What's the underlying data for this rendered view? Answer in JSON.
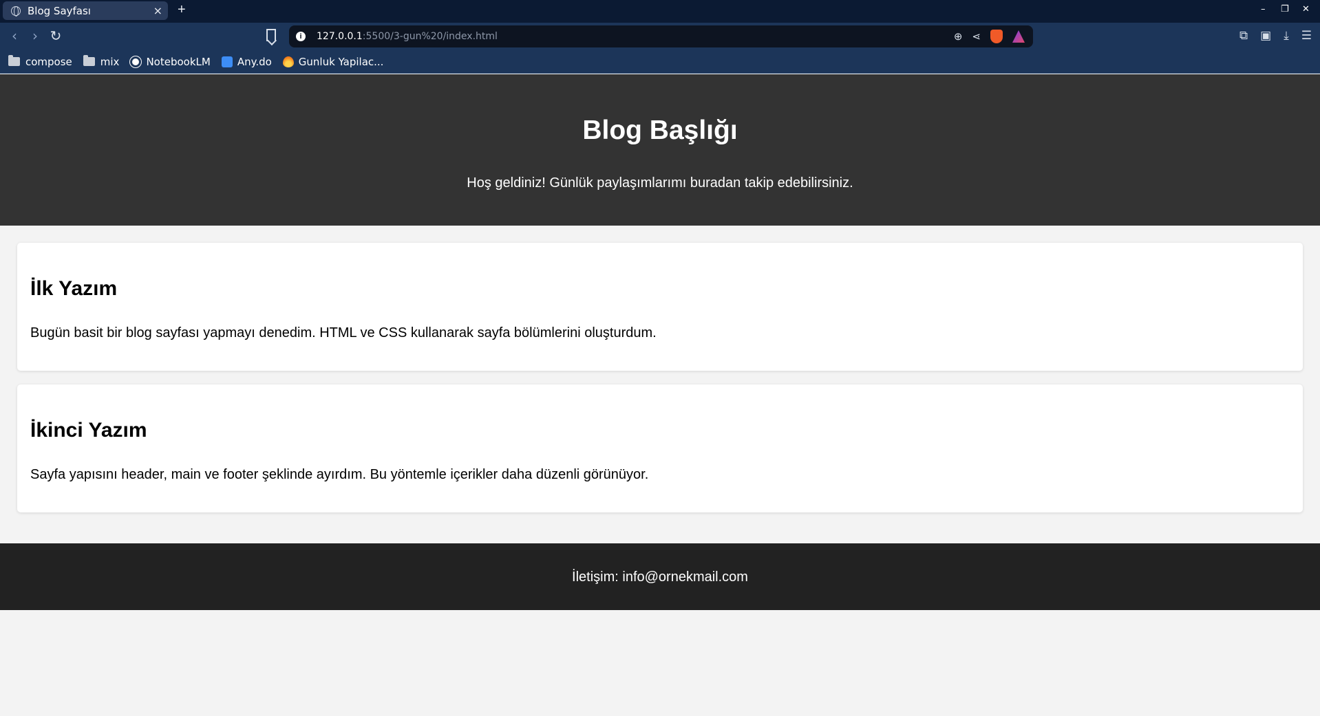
{
  "browser": {
    "tab_title": "Blog Sayfası",
    "tab_close": "×",
    "new_tab": "+",
    "url_host": "127.0.0.1",
    "url_path": ":5500/3-gun%20/index.html",
    "window_controls": {
      "minimize": "–",
      "maximize": "❐",
      "close": "✕"
    },
    "bookmarks": [
      "compose",
      "mix",
      "NotebookLM",
      "Any.do",
      "Gunluk Yapilac..."
    ]
  },
  "header": {
    "title": "Blog Başlığı",
    "subtitle": "Hoş geldiniz! Günlük paylaşımlarımı buradan takip edebilirsiniz."
  },
  "posts": [
    {
      "title": "İlk Yazım",
      "body": "Bugün basit bir blog sayfası yapmayı denedim. HTML ve CSS kullanarak sayfa bölümlerini oluşturdum."
    },
    {
      "title": "İkinci Yazım",
      "body": "Sayfa yapısını header, main ve footer şeklinde ayırdım. Bu yöntemle içerikler daha düzenli görünüyor."
    }
  ],
  "footer": {
    "contact": "İletişim: info@ornekmail.com"
  }
}
